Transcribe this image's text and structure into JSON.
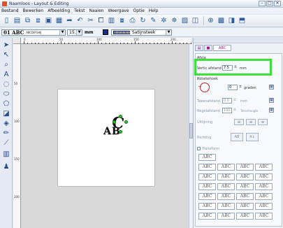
{
  "window": {
    "title": "Naamloos - Layout & Editing",
    "buttons": [
      "–",
      "□",
      "✕"
    ]
  },
  "menu": [
    "Bestand",
    "Bewerken",
    "Afbeelding",
    "Tekst",
    "Naaien",
    "Weergave",
    "Optie",
    "Help"
  ],
  "toolbar2": {
    "font_name": "01 ABC",
    "font_preview": "ABCDEFGHIJ",
    "size": "15.5",
    "unit": "mm",
    "stitch_label": "Satijnsteek",
    "color": "#1a2f8a"
  },
  "ruler": {
    "top_numbers": [
      "0",
      "50",
      "100",
      "150",
      "200"
    ],
    "left_numbers": [
      "50",
      "100",
      "150",
      "200"
    ]
  },
  "canvas": {
    "text": "AB",
    "curved_letter": "C"
  },
  "panel": {
    "tab_label": "ABC",
    "align_label": "Afsta",
    "vertical_offset_label": "Vertic",
    "vertical_offset_sub": "afstand",
    "vertical_offset_value": "7.5",
    "vertical_offset_unit": "mm",
    "rotation_label": "Rotatiehoek",
    "rotation_value": "0",
    "rotation_unit": "graden",
    "char_spacing_label": "Tekenafstand",
    "char_spacing_value": "0.0",
    "char_spacing_unit": "mm",
    "line_spacing_label": "Regelafstand",
    "line_spacing_value": "100",
    "line_spacing_unit": "Tekenhoogte",
    "alignment_label": "Uitlijning",
    "direction_label": "Richting",
    "transform_label": "Transform",
    "direction_buttons": [
      "AB",
      "A↓"
    ],
    "style_cells": [
      "ABC",
      "ABC",
      "ABC",
      "ABC",
      "ABC",
      "ABC",
      "ABC",
      "ABC",
      "ABC",
      "ABC",
      "ABC",
      "ABC",
      "ABC",
      "ABC",
      "ABC",
      "ABC",
      "ABC",
      "ABC",
      "ABC",
      "ABC",
      "ABC",
      "ABC",
      "ABC",
      "ABC",
      "ABC",
      "ABC",
      "ABC"
    ]
  }
}
